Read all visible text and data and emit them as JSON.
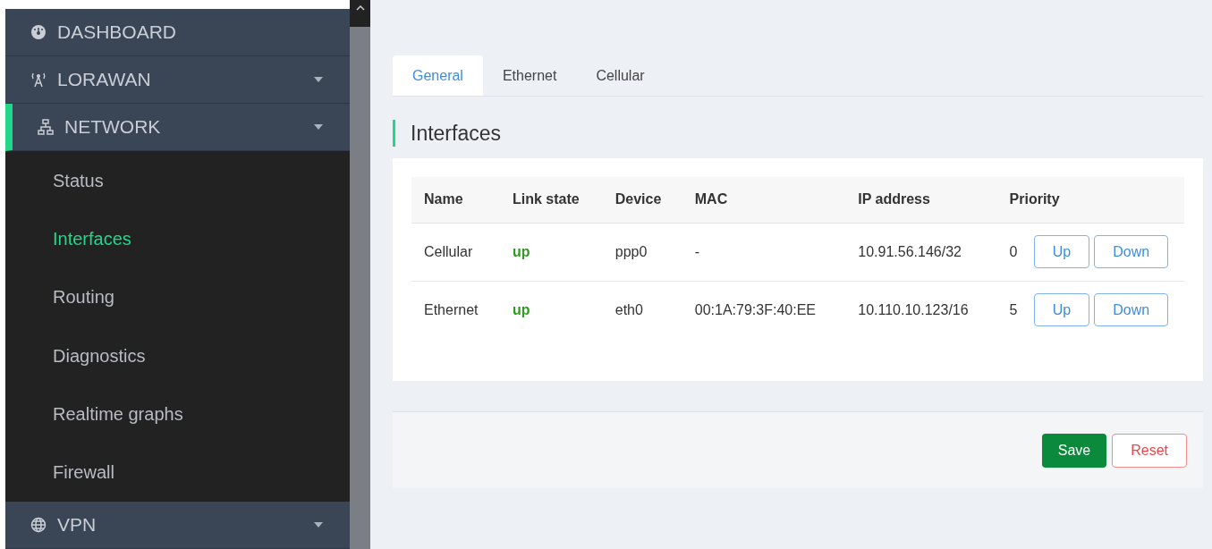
{
  "sidebar": {
    "items": [
      {
        "label": "DASHBOARD",
        "caret": false,
        "selected": false
      },
      {
        "label": "LORAWAN",
        "caret": true,
        "selected": false
      },
      {
        "label": "NETWORK",
        "caret": true,
        "selected": true,
        "children": [
          {
            "label": "Status",
            "selected": false
          },
          {
            "label": "Interfaces",
            "selected": true
          },
          {
            "label": "Routing",
            "selected": false
          },
          {
            "label": "Diagnostics",
            "selected": false
          },
          {
            "label": "Realtime graphs",
            "selected": false
          },
          {
            "label": "Firewall",
            "selected": false
          }
        ]
      },
      {
        "label": "VPN",
        "caret": true,
        "selected": false
      }
    ]
  },
  "tabs": [
    {
      "label": "General",
      "selected": true
    },
    {
      "label": "Ethernet",
      "selected": false
    },
    {
      "label": "Cellular",
      "selected": false
    }
  ],
  "heading": "Interfaces",
  "table": {
    "columns": [
      "Name",
      "Link state",
      "Device",
      "MAC",
      "IP address",
      "Priority"
    ],
    "rows": [
      {
        "cells": [
          "Cellular",
          "up",
          "ppp0",
          "-",
          "10.91.56.146/32",
          "0"
        ],
        "buttons": [
          "Up",
          "Down"
        ]
      },
      {
        "cells": [
          "Ethernet",
          "up",
          "eth0",
          "00:1A:79:3F:40:EE",
          "10.110.10.123/16",
          "5"
        ],
        "buttons": [
          "Up",
          "Down"
        ]
      }
    ]
  },
  "actions": [
    {
      "kind": "primary",
      "label": "Save"
    },
    {
      "kind": "danger",
      "label": "Reset"
    }
  ]
}
